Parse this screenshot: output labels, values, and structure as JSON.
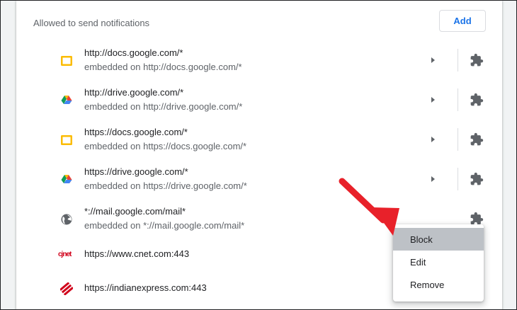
{
  "section": {
    "label": "Allowed to send notifications",
    "add_label": "Add"
  },
  "sites": [
    {
      "url": "http://docs.google.com/*",
      "embedded": "embedded on http://docs.google.com/*",
      "icon": "google-docs-icon"
    },
    {
      "url": "http://drive.google.com/*",
      "embedded": "embedded on http://drive.google.com/*",
      "icon": "google-drive-icon"
    },
    {
      "url": "https://docs.google.com/*",
      "embedded": "embedded on https://docs.google.com/*",
      "icon": "google-docs-icon"
    },
    {
      "url": "https://drive.google.com/*",
      "embedded": "embedded on https://drive.google.com/*",
      "icon": "google-drive-icon"
    },
    {
      "url": "*://mail.google.com/mail*",
      "embedded": "embedded on *://mail.google.com/mail*",
      "icon": "globe-icon"
    },
    {
      "url": "https://www.cnet.com:443",
      "icon": "cnet-icon",
      "icon_text": "cjnet"
    },
    {
      "url": "https://indianexpress.com:443",
      "icon": "indianexpress-icon"
    }
  ],
  "menu": {
    "items": [
      "Block",
      "Edit",
      "Remove"
    ],
    "highlighted": "Block"
  },
  "colors": {
    "accent": "#1a73e8",
    "docs_yellow": "#fbbc04",
    "annotation_red": "#e8212a",
    "cnet_red": "#d0021b",
    "menu_highlight": "#bdc1c6"
  }
}
